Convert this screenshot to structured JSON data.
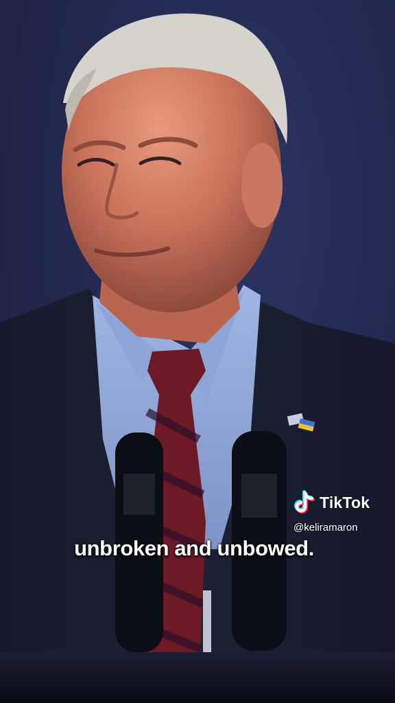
{
  "video": {
    "caption": "unbroken and unbowed.",
    "description": ""
  },
  "watermark": {
    "brand": "TikTok",
    "handle": "@keliramaron",
    "logo_icon": "tiktok-note-icon"
  },
  "colors": {
    "backdrop": "#232a52",
    "caption_text": "#ffffff",
    "tiktok_cyan": "#25f4ee",
    "tiktok_pink": "#fe2c55"
  }
}
